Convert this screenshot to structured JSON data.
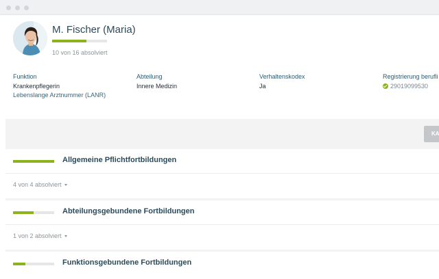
{
  "window": {
    "controls": [
      "close",
      "minimize",
      "maximize"
    ]
  },
  "profile": {
    "name": "M. Fischer (Maria)",
    "progress_text": "10 von 16 absolviert",
    "progress_fraction": 0.625,
    "avatar_icon": "person-photo",
    "info": [
      {
        "label": "Funktion",
        "value": "Krankenpflegerin",
        "sub": "Lebenslange Arztnummer (LANR)"
      },
      {
        "label": "Abteilung",
        "value": "Innere Medizin"
      },
      {
        "label": "Verhaltenskodex",
        "value": "Ja"
      },
      {
        "label": "Registrierung berufli",
        "value": "29019099530",
        "icon": "check-circle-icon"
      }
    ]
  },
  "toolbar": {
    "button_label": "KAT"
  },
  "sections": [
    {
      "title": "Allgemeine Pflichtfortbildungen",
      "status": "4 von 4 absolviert",
      "progress_fraction": 1.0
    },
    {
      "title": "Abteilungsgebundene Fortbildungen",
      "status": "1 von 2 absolviert",
      "progress_fraction": 0.5
    },
    {
      "title": "Funktionsgebundene Fortbildungen",
      "progress_fraction": 0.3
    }
  ],
  "colors": {
    "accent": "#8bb31d",
    "heading": "#2b4a5a",
    "muted": "#8a949b",
    "panel_bg": "#f3f3f3"
  }
}
